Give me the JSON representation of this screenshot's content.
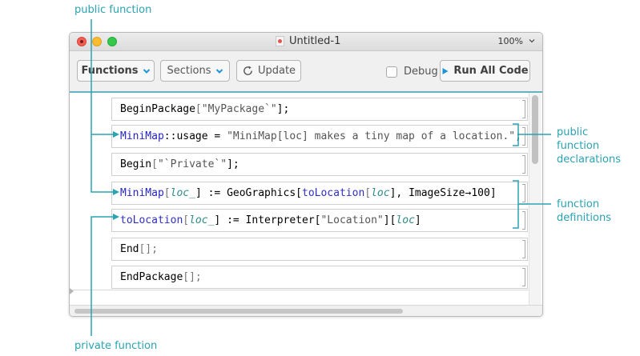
{
  "annotations": {
    "public_function": "public function",
    "private_function": "private function",
    "public_function_declarations": [
      "public",
      "function",
      "declarations"
    ],
    "function_definitions": [
      "function",
      "definitions"
    ]
  },
  "window": {
    "title": "Untitled-1",
    "zoom": "100%"
  },
  "toolbar": {
    "functions_label": "Functions",
    "sections_label": "Sections",
    "update_label": "Update",
    "debug_label": "Debug",
    "debug_checked": false,
    "run_all_label": "Run All Code"
  },
  "cells": [
    {
      "tokens": [
        {
          "t": "BeginPackage",
          "c": ""
        },
        {
          "t": "[",
          "c": "gray"
        },
        {
          "t": "\"MyPackage`\"",
          "c": "str"
        },
        {
          "t": "];",
          "c": ""
        }
      ]
    },
    {
      "tokens": [
        {
          "t": "MiniMap",
          "c": "blue"
        },
        {
          "t": "::usage = ",
          "c": ""
        },
        {
          "t": "\"MiniMap[loc] makes a tiny map of a location.\"",
          "c": "str"
        },
        {
          "t": ";",
          "c": ""
        }
      ]
    },
    {
      "tokens": [
        {
          "t": "Begin",
          "c": ""
        },
        {
          "t": "[",
          "c": "gray"
        },
        {
          "t": "\"`Private`\"",
          "c": "str"
        },
        {
          "t": "];",
          "c": ""
        }
      ]
    },
    {
      "tokens": [
        {
          "t": "MiniMap",
          "c": "blue"
        },
        {
          "t": "[",
          "c": "gray"
        },
        {
          "t": "loc_",
          "c": "teal"
        },
        {
          "t": "] := GeoGraphics[",
          "c": ""
        },
        {
          "t": "toLocation",
          "c": "fn-blue"
        },
        {
          "t": "[",
          "c": "gray"
        },
        {
          "t": "loc",
          "c": "teal"
        },
        {
          "t": "], ImageSize→100]",
          "c": ""
        }
      ]
    },
    {
      "tokens": [
        {
          "t": "toLocation",
          "c": "fn-blue"
        },
        {
          "t": "[",
          "c": "gray"
        },
        {
          "t": "loc_",
          "c": "teal"
        },
        {
          "t": "] := Interpreter[",
          "c": ""
        },
        {
          "t": "\"Location\"",
          "c": "str"
        },
        {
          "t": "][",
          "c": ""
        },
        {
          "t": "loc",
          "c": "teal"
        },
        {
          "t": "]",
          "c": ""
        }
      ]
    },
    {
      "tokens": [
        {
          "t": "End",
          "c": ""
        },
        {
          "t": "[];",
          "c": "gray"
        }
      ]
    },
    {
      "tokens": [
        {
          "t": "EndPackage",
          "c": ""
        },
        {
          "t": "[];",
          "c": "gray"
        }
      ]
    }
  ],
  "colors": {
    "annotation": "#2aa3b2",
    "accent_line": "#63b4c0",
    "symbol_blue": "#2525c4",
    "pattern_teal": "#2f8a8a"
  },
  "icons": [
    "chevron-down-icon",
    "refresh-icon",
    "play-icon",
    "close-icon"
  ]
}
